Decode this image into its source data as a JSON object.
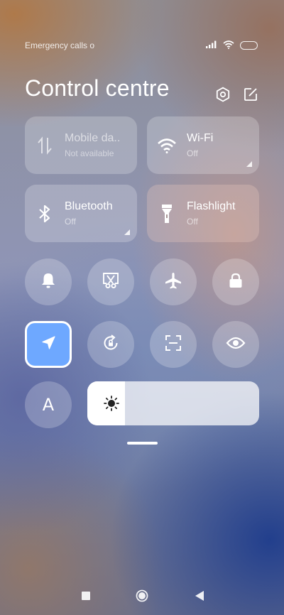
{
  "status_bar": {
    "text": "Emergency calls o",
    "signal_icon": "signal-icon",
    "wifi_icon": "wifi-icon",
    "battery_icon": "battery-icon"
  },
  "header": {
    "title": "Control centre",
    "settings_icon": "settings-icon",
    "edit_icon": "edit-icon"
  },
  "tiles": [
    {
      "name": "Mobile da..",
      "status": "Not available",
      "icon": "mobile-data-icon",
      "enabled": false
    },
    {
      "name": "Wi-Fi",
      "status": "Off",
      "icon": "wifi-icon",
      "expandable": true
    },
    {
      "name": "Bluetooth",
      "status": "Off",
      "icon": "bluetooth-icon",
      "expandable": true
    },
    {
      "name": "Flashlight",
      "status": "Off",
      "icon": "flashlight-icon"
    }
  ],
  "quick_toggles": [
    "bell-icon",
    "screenshot-icon",
    "airplane-icon",
    "lock-icon",
    "location-icon",
    "rotation-lock-icon",
    "scan-icon",
    "eye-icon"
  ],
  "active_toggle": "location-icon",
  "auto_brightness_label": "A",
  "brightness": {
    "icon": "sun-icon",
    "level": 0.22
  },
  "nav_bar": [
    "recents-icon",
    "home-icon",
    "back-icon"
  ],
  "colors": {
    "accent": "#6ea8ff"
  }
}
